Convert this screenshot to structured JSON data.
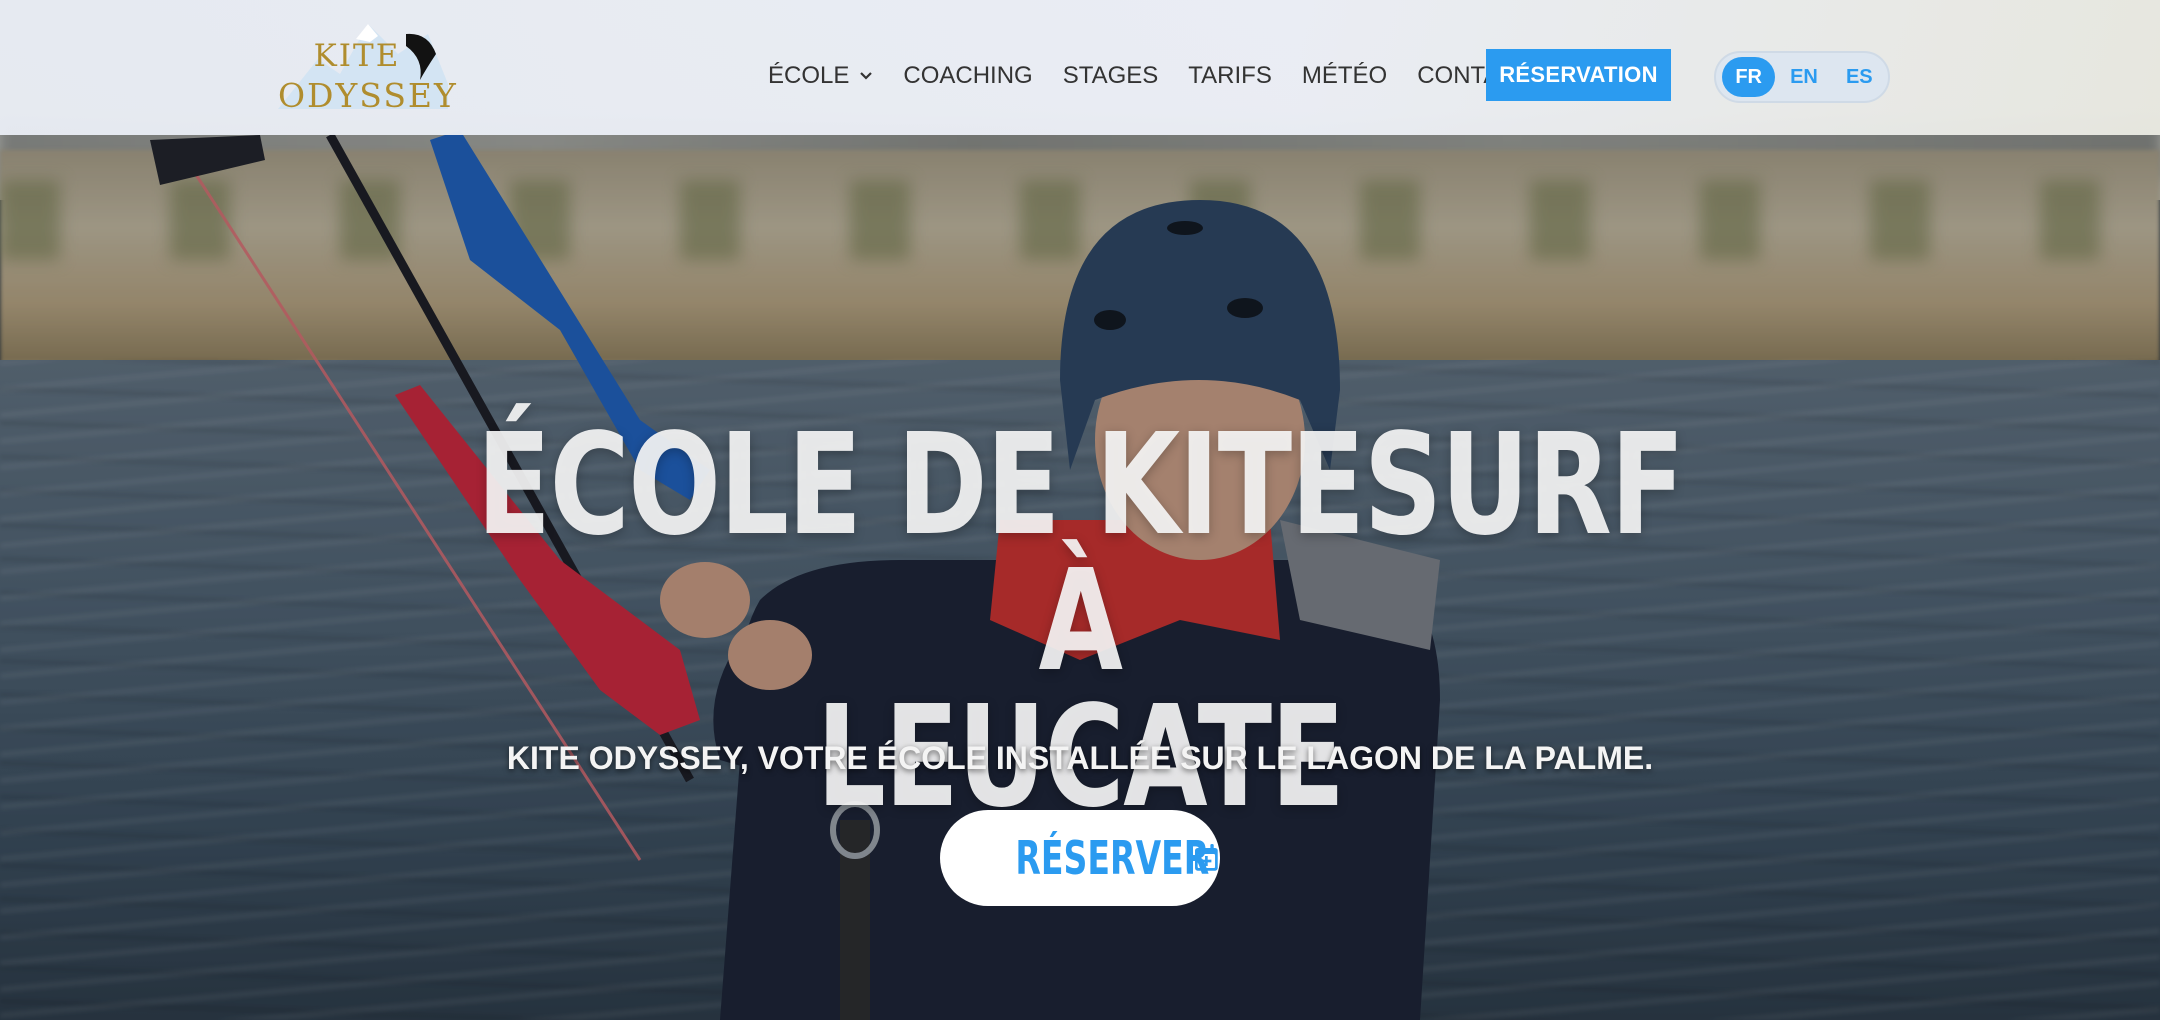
{
  "header": {
    "logo": {
      "line1": "KITE",
      "line2": "ODYSSEY"
    },
    "nav": {
      "items": [
        {
          "label": "ÉCOLE",
          "has_dropdown": true
        },
        {
          "label": "COACHING"
        },
        {
          "label": "STAGES"
        },
        {
          "label": "TARIFS"
        },
        {
          "label": "MÉTÉO"
        },
        {
          "label": "CONTACT"
        }
      ]
    },
    "cta_label": "RÉSERVATION",
    "languages": [
      {
        "code": "FR",
        "active": true
      },
      {
        "code": "EN",
        "active": false
      },
      {
        "code": "ES",
        "active": false
      }
    ]
  },
  "hero": {
    "title_line1": "ÉCOLE DE KITESURF À",
    "title_line2": "LEUCATE",
    "subtitle": "KITE ODYSSEY, VOTRE ÉCOLE INSTALLÉE SUR LE LAGON DE LA PALME.",
    "book_button": {
      "label": "RÉSERVER",
      "icon": "calendar-plus-icon"
    }
  },
  "colors": {
    "accent": "#2b9bf0",
    "logo_gold": "#b08d2e",
    "header_bg": "#eaedf3"
  }
}
